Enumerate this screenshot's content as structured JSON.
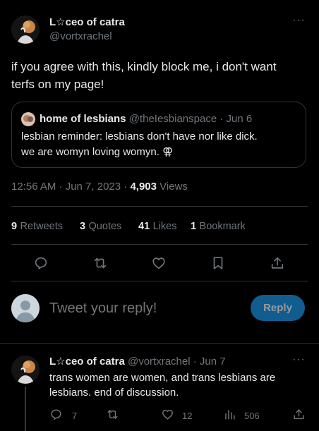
{
  "tweet": {
    "author_name": "L☆ceo of catra",
    "author_handle": "@vortxrachel",
    "more": "···",
    "text_line1": "if you agree with this, kindly block me, i don't want",
    "text_line2": "terfs on my page!",
    "quote": {
      "name": "home of lesbians",
      "handle": "@theIesbianspace",
      "sep": "·",
      "date": "Jun 6",
      "line1": "lesbian reminder: lesbians don't have nor like dick.",
      "line2": "we are womyn loving womyn. ⚢"
    },
    "time": "12:56 AM · Jun 7, 2023 ·",
    "views_count": "4,903",
    "views_label": "Views",
    "stats": [
      {
        "num": "9",
        "label": "Retweets"
      },
      {
        "num": "3",
        "label": "Quotes"
      },
      {
        "num": "41",
        "label": "Likes"
      },
      {
        "num": "1",
        "label": "Bookmark"
      }
    ]
  },
  "composer": {
    "placeholder": "Tweet your reply!",
    "button": "Reply"
  },
  "reply": {
    "author_name": "L☆ceo of catra",
    "author_handle": "@vortxrachel",
    "sep": "·",
    "date": "Jun 7",
    "more": "···",
    "line1": "trans women are women, and trans lesbians are",
    "line2": "lesbians. end of discussion.",
    "replies": "7",
    "likes": "12",
    "views": "506"
  },
  "colors": {
    "background": "#000000",
    "text": "#e7e9ea",
    "secondary": "#71767b",
    "accent": "#1d9bf0",
    "border": "#2f3336"
  }
}
